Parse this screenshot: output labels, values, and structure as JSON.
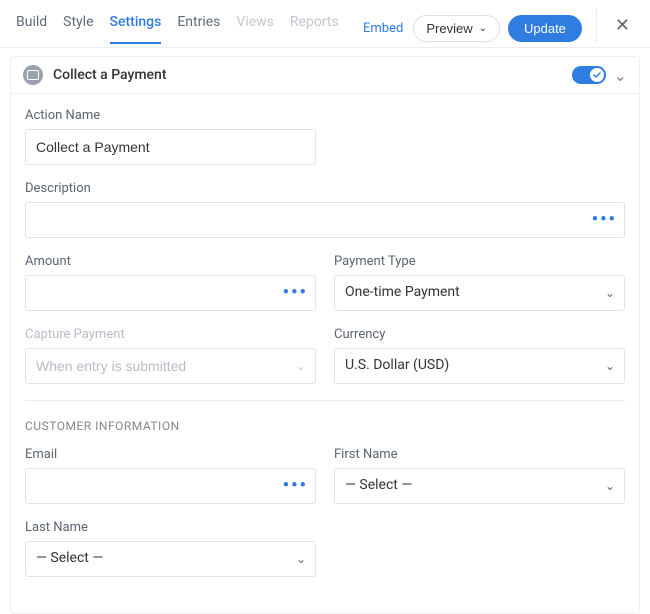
{
  "topbar": {
    "tabs": {
      "build": "Build",
      "style": "Style",
      "settings": "Settings",
      "entries": "Entries",
      "views": "Views",
      "reports": "Reports"
    },
    "embed": "Embed",
    "preview": "Preview",
    "update": "Update"
  },
  "panel": {
    "title": "Collect a Payment"
  },
  "fields": {
    "action_name": {
      "label": "Action Name",
      "value": "Collect a Payment"
    },
    "description": {
      "label": "Description",
      "value": ""
    },
    "amount": {
      "label": "Amount",
      "value": ""
    },
    "payment_type": {
      "label": "Payment Type",
      "value": "One-time Payment"
    },
    "capture_payment": {
      "label": "Capture Payment",
      "placeholder": "When entry is submitted"
    },
    "currency": {
      "label": "Currency",
      "value": "U.S. Dollar (USD)"
    }
  },
  "customer": {
    "section": "CUSTOMER INFORMATION",
    "email": {
      "label": "Email",
      "value": ""
    },
    "first_name": {
      "label": "First Name",
      "value": "— Select —"
    },
    "last_name": {
      "label": "Last Name",
      "value": "— Select —"
    }
  }
}
